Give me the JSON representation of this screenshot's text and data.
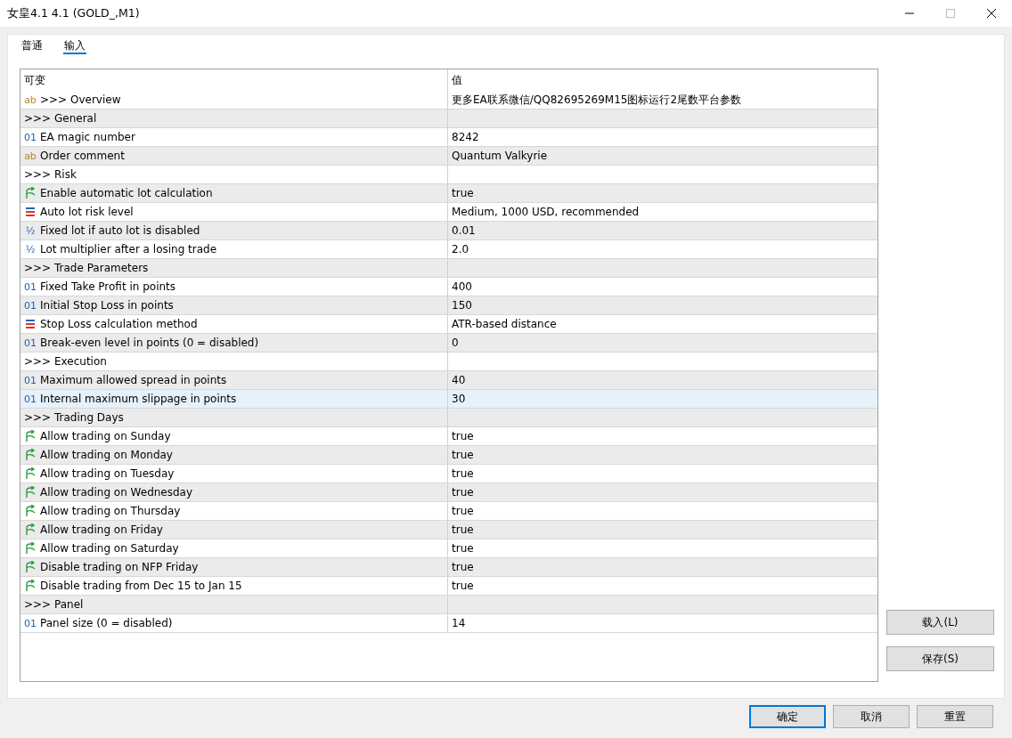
{
  "window": {
    "title": "女皇4.1 4.1 (GOLD_,M1)"
  },
  "tabs": [
    {
      "label": "普通",
      "selected": false
    },
    {
      "label": "输入",
      "selected": true
    }
  ],
  "table": {
    "columns": [
      "可变",
      "值"
    ],
    "rows": [
      {
        "kind": "string",
        "icon_text": "ab",
        "name": ">>> Overview",
        "value": "更多EA联系微信/QQ82695269M15图标运行2尾数平台参数",
        "selected": false
      },
      {
        "kind": "section",
        "name": ">>> General",
        "value": "",
        "selected": false
      },
      {
        "kind": "int",
        "icon_text": "01",
        "name": "EA magic number",
        "value": "8242",
        "selected": false
      },
      {
        "kind": "string",
        "icon_text": "ab",
        "name": "Order comment",
        "value": "Quantum Valkyrie",
        "selected": false
      },
      {
        "kind": "section",
        "name": ">>> Risk",
        "value": "",
        "selected": false
      },
      {
        "kind": "bool",
        "name": "Enable automatic lot calculation",
        "value": "true",
        "selected": false
      },
      {
        "kind": "enum",
        "name": "Auto lot risk level",
        "value": "Medium, 1000 USD, recommended",
        "selected": false
      },
      {
        "kind": "double",
        "icon_text": "½",
        "name": "Fixed lot if auto lot is disabled",
        "value": "0.01",
        "selected": false
      },
      {
        "kind": "double",
        "icon_text": "½",
        "name": "Lot multiplier after a losing trade",
        "value": "2.0",
        "selected": false
      },
      {
        "kind": "section",
        "name": ">>> Trade Parameters",
        "value": "",
        "selected": false
      },
      {
        "kind": "int",
        "icon_text": "01",
        "name": "Fixed Take Profit in points",
        "value": "400",
        "selected": false
      },
      {
        "kind": "int",
        "icon_text": "01",
        "name": "Initial Stop Loss in points",
        "value": "150",
        "selected": false
      },
      {
        "kind": "enum",
        "name": "Stop Loss calculation method",
        "value": "ATR-based distance",
        "selected": false
      },
      {
        "kind": "int",
        "icon_text": "01",
        "name": "Break-even level in points (0 = disabled)",
        "value": "0",
        "selected": false
      },
      {
        "kind": "section",
        "name": ">>> Execution",
        "value": "",
        "selected": false
      },
      {
        "kind": "int",
        "icon_text": "01",
        "name": "Maximum allowed spread in points",
        "value": "40",
        "selected": false
      },
      {
        "kind": "int",
        "icon_text": "01",
        "name": "Internal maximum slippage in points",
        "value": "30",
        "selected": true
      },
      {
        "kind": "section",
        "name": ">>> Trading Days",
        "value": "",
        "selected": false
      },
      {
        "kind": "bool",
        "name": "Allow trading on Sunday",
        "value": "true",
        "selected": false
      },
      {
        "kind": "bool",
        "name": "Allow trading on Monday",
        "value": "true",
        "selected": false
      },
      {
        "kind": "bool",
        "name": "Allow trading on Tuesday",
        "value": "true",
        "selected": false
      },
      {
        "kind": "bool",
        "name": "Allow trading on Wednesday",
        "value": "true",
        "selected": false
      },
      {
        "kind": "bool",
        "name": "Allow trading on Thursday",
        "value": "true",
        "selected": false
      },
      {
        "kind": "bool",
        "name": "Allow trading on Friday",
        "value": "true",
        "selected": false
      },
      {
        "kind": "bool",
        "name": "Allow trading on Saturday",
        "value": "true",
        "selected": false
      },
      {
        "kind": "bool",
        "name": "Disable trading on NFP Friday",
        "value": "true",
        "selected": false
      },
      {
        "kind": "bool",
        "name": "Disable trading from Dec 15 to Jan 15",
        "value": "true",
        "selected": false
      },
      {
        "kind": "section",
        "name": ">>> Panel",
        "value": "",
        "selected": false
      },
      {
        "kind": "int",
        "icon_text": "01",
        "name": "Panel size (0 = disabled)",
        "value": "14",
        "selected": false
      }
    ]
  },
  "side_buttons": [
    "载入(L)",
    "保存(S)"
  ],
  "buttons": [
    {
      "label": "确定",
      "default": true
    },
    {
      "label": "取消",
      "default": false
    },
    {
      "label": "重置",
      "default": false
    }
  ]
}
